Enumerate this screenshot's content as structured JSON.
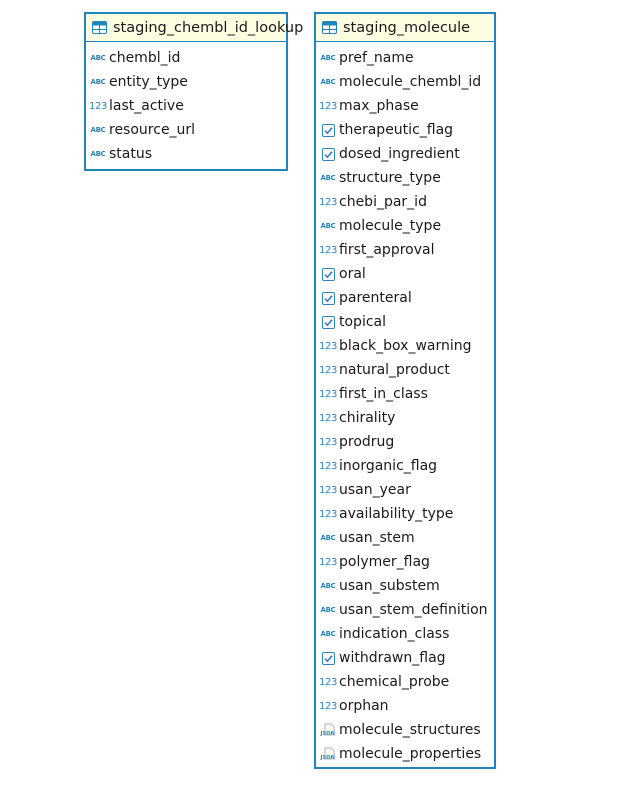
{
  "tables": [
    {
      "name": "staging_chembl_id_lookup",
      "columns": [
        {
          "name": "chembl_id",
          "icon": "abc"
        },
        {
          "name": "entity_type",
          "icon": "abc"
        },
        {
          "name": "last_active",
          "icon": "123"
        },
        {
          "name": "resource_url",
          "icon": "abc"
        },
        {
          "name": "status",
          "icon": "abc"
        }
      ]
    },
    {
      "name": "staging_molecule",
      "columns": [
        {
          "name": "pref_name",
          "icon": "abc"
        },
        {
          "name": "molecule_chembl_id",
          "icon": "abc"
        },
        {
          "name": "max_phase",
          "icon": "123"
        },
        {
          "name": "therapeutic_flag",
          "icon": "checkbox"
        },
        {
          "name": "dosed_ingredient",
          "icon": "checkbox"
        },
        {
          "name": "structure_type",
          "icon": "abc"
        },
        {
          "name": "chebi_par_id",
          "icon": "123"
        },
        {
          "name": "molecule_type",
          "icon": "abc"
        },
        {
          "name": "first_approval",
          "icon": "123"
        },
        {
          "name": "oral",
          "icon": "checkbox"
        },
        {
          "name": "parenteral",
          "icon": "checkbox"
        },
        {
          "name": "topical",
          "icon": "checkbox"
        },
        {
          "name": "black_box_warning",
          "icon": "123"
        },
        {
          "name": "natural_product",
          "icon": "123"
        },
        {
          "name": "first_in_class",
          "icon": "123"
        },
        {
          "name": "chirality",
          "icon": "123"
        },
        {
          "name": "prodrug",
          "icon": "123"
        },
        {
          "name": "inorganic_flag",
          "icon": "123"
        },
        {
          "name": "usan_year",
          "icon": "123"
        },
        {
          "name": "availability_type",
          "icon": "123"
        },
        {
          "name": "usan_stem",
          "icon": "abc"
        },
        {
          "name": "polymer_flag",
          "icon": "123"
        },
        {
          "name": "usan_substem",
          "icon": "abc"
        },
        {
          "name": "usan_stem_definition",
          "icon": "abc"
        },
        {
          "name": "indication_class",
          "icon": "abc"
        },
        {
          "name": "withdrawn_flag",
          "icon": "checkbox"
        },
        {
          "name": "chemical_probe",
          "icon": "123"
        },
        {
          "name": "orphan",
          "icon": "123"
        },
        {
          "name": "molecule_structures",
          "icon": "json"
        },
        {
          "name": "molecule_properties",
          "icon": "json"
        }
      ]
    }
  ],
  "icon_labels": {
    "abc": "ABC",
    "num": "123",
    "json": "JSON"
  },
  "colors": {
    "border": "#1f86bd",
    "header_bg": "#fdfde2",
    "icon": "#2a84b8"
  }
}
